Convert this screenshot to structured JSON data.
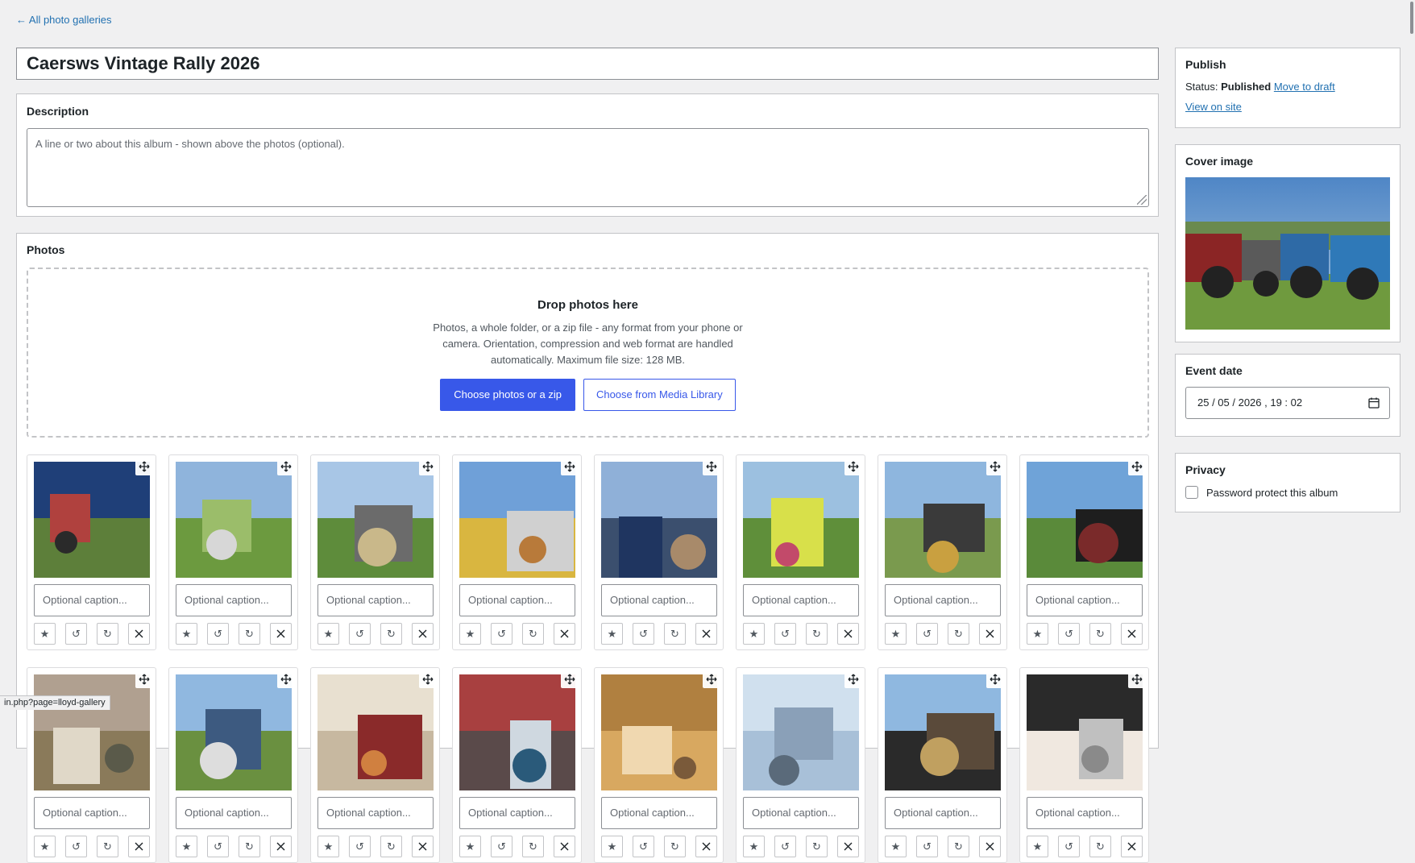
{
  "nav": {
    "back_link": "← All photo galleries"
  },
  "album": {
    "title": "Caersws Vintage Rally 2026"
  },
  "description": {
    "heading": "Description",
    "placeholder": "A line or two about this album - shown above the photos (optional)."
  },
  "photos": {
    "heading": "Photos",
    "dropzone": {
      "title": "Drop photos here",
      "help": "Photos, a whole folder, or a zip file - any format from your phone or camera. Orientation, compression and web format are handled automatically. Maximum file size: 128 MB.",
      "primary_button": "Choose photos or a zip",
      "secondary_button": "Choose from Media Library"
    },
    "caption_placeholder": "Optional caption...",
    "actions": {
      "cover": "★",
      "rotate_left": "↺",
      "rotate_right": "↻"
    }
  },
  "publish": {
    "heading": "Publish",
    "status_label": "Status:",
    "status_value": "Published",
    "move_to_draft": "Move to draft",
    "view_on_site": "View on site"
  },
  "cover": {
    "heading": "Cover image"
  },
  "event_date": {
    "heading": "Event date",
    "value": "25 / 05 / 2026 ,  19 : 02"
  },
  "privacy": {
    "heading": "Privacy",
    "password_label": "Password protect this album"
  },
  "status_bar": {
    "url": "in.php?page=lloyd-gallery"
  },
  "colors": {
    "accent": "#3858e9",
    "link": "#2271b1",
    "page_bg": "#f0f0f1"
  }
}
